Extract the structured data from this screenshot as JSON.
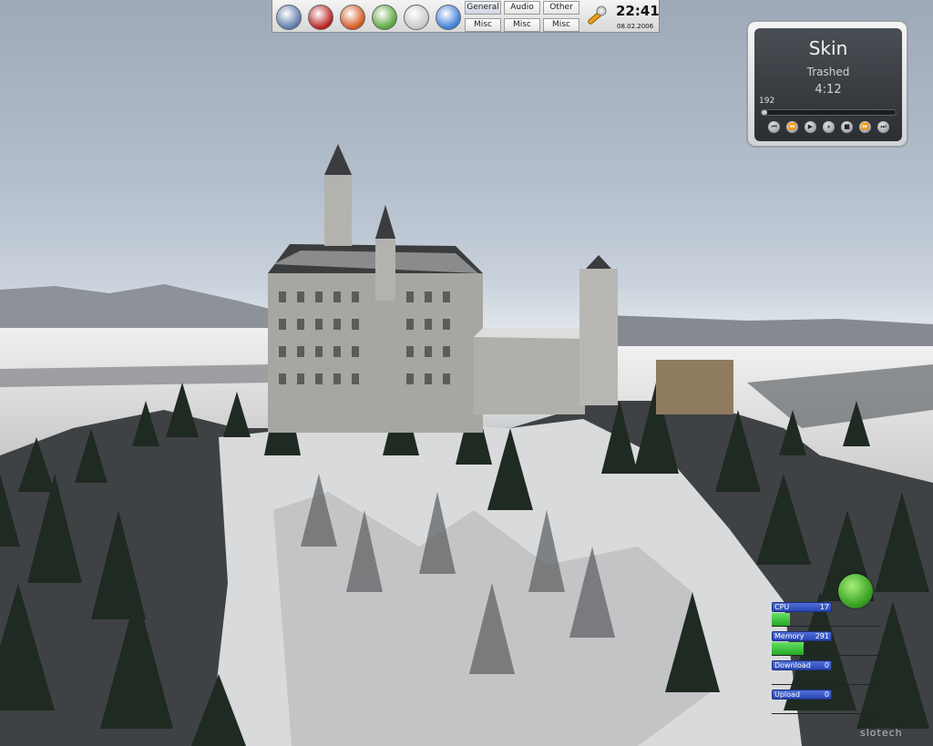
{
  "panel": {
    "launchers": [
      {
        "name": "finder-icon",
        "color": "#5b78a8"
      },
      {
        "name": "red-globe-icon",
        "color": "#b71d1d"
      },
      {
        "name": "home-icon",
        "color": "#d2561b"
      },
      {
        "name": "tools-icon",
        "color": "#5aa43a"
      },
      {
        "name": "cd-icon",
        "color": "#c8c8c8"
      },
      {
        "name": "music-note-icon",
        "color": "#3b7bd8"
      }
    ],
    "pager": {
      "top": [
        "General",
        "Audio",
        "Other"
      ],
      "bottom": [
        "Misc",
        "Misc",
        "Misc"
      ]
    },
    "wrench_icon": "wrench-icon",
    "clock": {
      "time": "22:41",
      "date": "08.02.2006"
    }
  },
  "player": {
    "title": "Skin",
    "subtitle": "Trashed",
    "time": "4:12",
    "bitrate": "192",
    "progress": 0.04,
    "buttons": [
      "rewind",
      "previous",
      "play",
      "pause",
      "stop",
      "next",
      "end"
    ]
  },
  "sysmon": {
    "rows": [
      {
        "label": "CPU",
        "value": "17",
        "fill": 0.17
      },
      {
        "label": "Memory",
        "value": "291",
        "fill": 0.29
      },
      {
        "label": "Download",
        "value": "0",
        "fill": 0
      },
      {
        "label": "Upload",
        "value": "0",
        "fill": 0
      }
    ]
  },
  "watermark": "slotech"
}
